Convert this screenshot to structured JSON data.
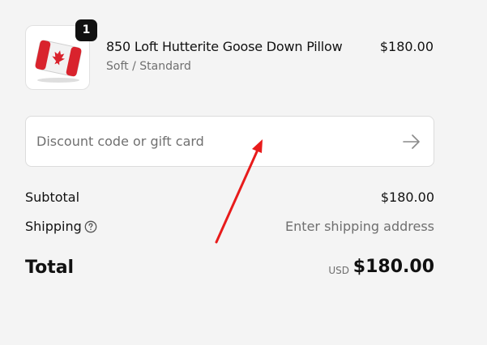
{
  "product": {
    "name": "850 Loft Hutterite Goose Down Pillow",
    "variant": "Soft / Standard",
    "price": "$180.00",
    "quantity": "1",
    "image_icon": "canadian-flag-pillow-icon"
  },
  "discount": {
    "placeholder": "Discount code or gift card",
    "value": "",
    "apply_icon": "arrow-right-icon"
  },
  "summary": {
    "subtotal_label": "Subtotal",
    "subtotal_value": "$180.00",
    "shipping_label": "Shipping",
    "shipping_help_icon": "question-circle-icon",
    "shipping_value": "Enter shipping address",
    "total_label": "Total",
    "currency": "USD",
    "total_value": "$180.00"
  },
  "colors": {
    "background": "#f4f4f4",
    "annotation": "#e81b1b",
    "muted_text": "#6f6f6f"
  }
}
